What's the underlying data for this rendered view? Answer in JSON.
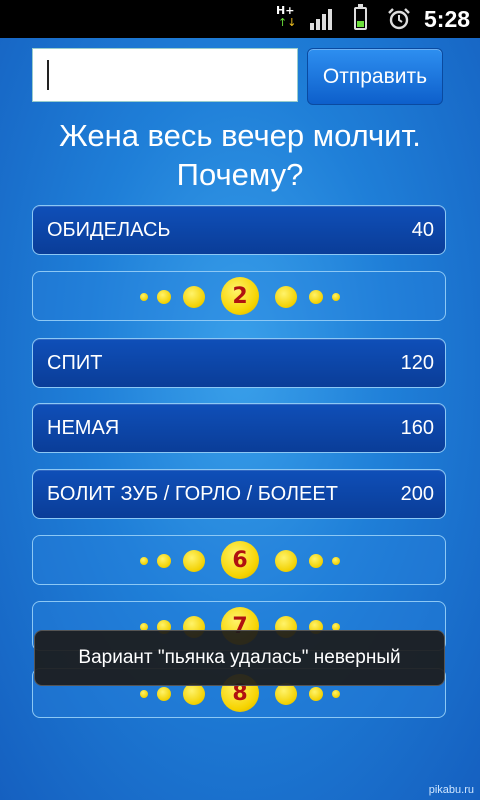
{
  "status_bar": {
    "network_label": "H+",
    "time": "5:28"
  },
  "input": {
    "value": "",
    "send_label": "Отправить"
  },
  "question": {
    "line1": "Жена весь вечер молчит.",
    "line2": "Почему?"
  },
  "answers": [
    {
      "state": "open",
      "text": "ОБИДЕЛАСЬ",
      "score": "40"
    },
    {
      "state": "closed",
      "number": "2"
    },
    {
      "state": "open",
      "text": "СПИТ",
      "score": "120"
    },
    {
      "state": "open",
      "text": "НЕМАЯ",
      "score": "160"
    },
    {
      "state": "open",
      "text": "БОЛИТ ЗУБ / ГОРЛО / БОЛЕЕТ",
      "score": "200"
    },
    {
      "state": "closed",
      "number": "6"
    },
    {
      "state": "closed",
      "number": "7"
    },
    {
      "state": "closed",
      "number": "8"
    }
  ],
  "toast": {
    "message": "Вариант \"пьянка удалась\" неверный"
  },
  "watermark": "pikabu.ru",
  "colors": {
    "background": "#1f7fd8",
    "open_row": "#0f4fb8",
    "dot_yellow": "#f2d000",
    "number_red": "#b01010"
  }
}
